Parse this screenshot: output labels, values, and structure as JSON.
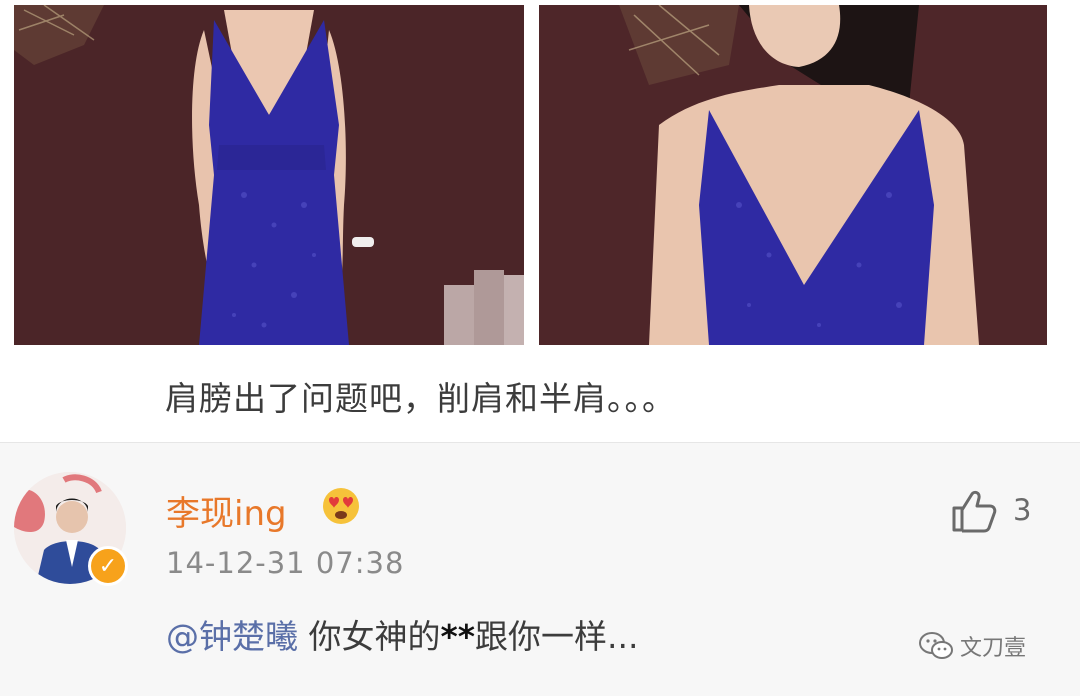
{
  "post": {
    "caption": "肩膀出了问题吧，削肩和半肩。。。"
  },
  "comment": {
    "username": "李现ing",
    "member_badge_icon": "emoji-heart-eyes-icon",
    "verified_icon": "verified-check-icon",
    "timestamp": "14-12-31 07:38",
    "like_icon": "thumbs-up-icon",
    "like_count": "3",
    "mention": "@钟楚曦",
    "text_before_censor": " 你女神的",
    "censored": "**",
    "text_after_censor": "跟你一样..."
  },
  "watermark": {
    "icon": "wechat-icon",
    "label": "文刀壹"
  },
  "colors": {
    "username": "#e8782a",
    "verified": "#f7a21b",
    "mention": "#5a6fa8",
    "dress": "#2e2aa0",
    "background_wall": "#4a2427"
  }
}
